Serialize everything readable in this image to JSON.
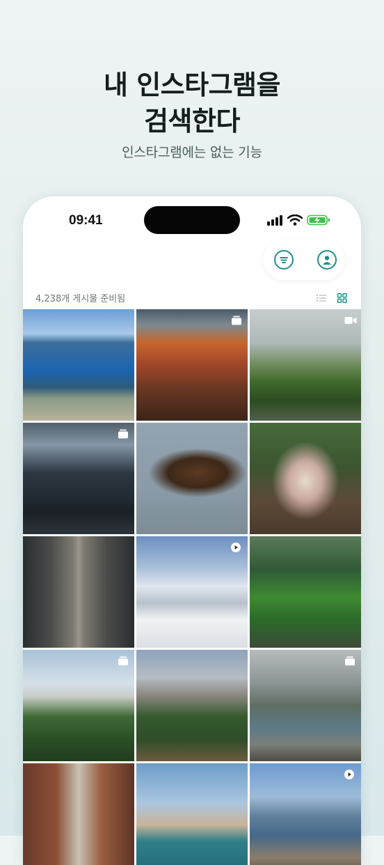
{
  "hero": {
    "title_line1": "내 인스타그램을",
    "title_line2": "검색한다",
    "subtitle": "인스타그램에는 없는 기능"
  },
  "status_bar": {
    "time": "09:41",
    "icons": [
      "signal-icon",
      "wifi-icon",
      "battery-charging-icon"
    ],
    "battery_color": "#3ec24a"
  },
  "toolbar": {
    "buttons": [
      {
        "name": "filter-button",
        "icon": "filter-lines-icon"
      },
      {
        "name": "profile-button",
        "icon": "user-icon"
      }
    ],
    "accent_color": "#1f8f8c"
  },
  "gallery": {
    "count_label": "4,238개 게시물 준비됨",
    "view_modes": [
      "list-view-icon",
      "grid-view-icon"
    ],
    "active_view": "grid-view-icon",
    "tiles": [
      {
        "subject": "fjord-cliff",
        "badge": ""
      },
      {
        "subject": "red-rock-sunset",
        "badge": "carousel"
      },
      {
        "subject": "green-hills-road",
        "badge": "video"
      },
      {
        "subject": "stormy-sea",
        "badge": "carousel"
      },
      {
        "subject": "vulture-flight",
        "badge": ""
      },
      {
        "subject": "pug-blanket",
        "badge": ""
      },
      {
        "subject": "escalator-station",
        "badge": ""
      },
      {
        "subject": "snowy-mountains",
        "badge": "reel"
      },
      {
        "subject": "forest-waterfall",
        "badge": ""
      },
      {
        "subject": "castle-forest",
        "badge": "carousel"
      },
      {
        "subject": "yosemite-valley",
        "badge": ""
      },
      {
        "subject": "misty-river",
        "badge": "carousel"
      },
      {
        "subject": "brick-alley",
        "badge": ""
      },
      {
        "subject": "coastal-rocks",
        "badge": ""
      },
      {
        "subject": "mountain-lake",
        "badge": "reel"
      }
    ]
  }
}
